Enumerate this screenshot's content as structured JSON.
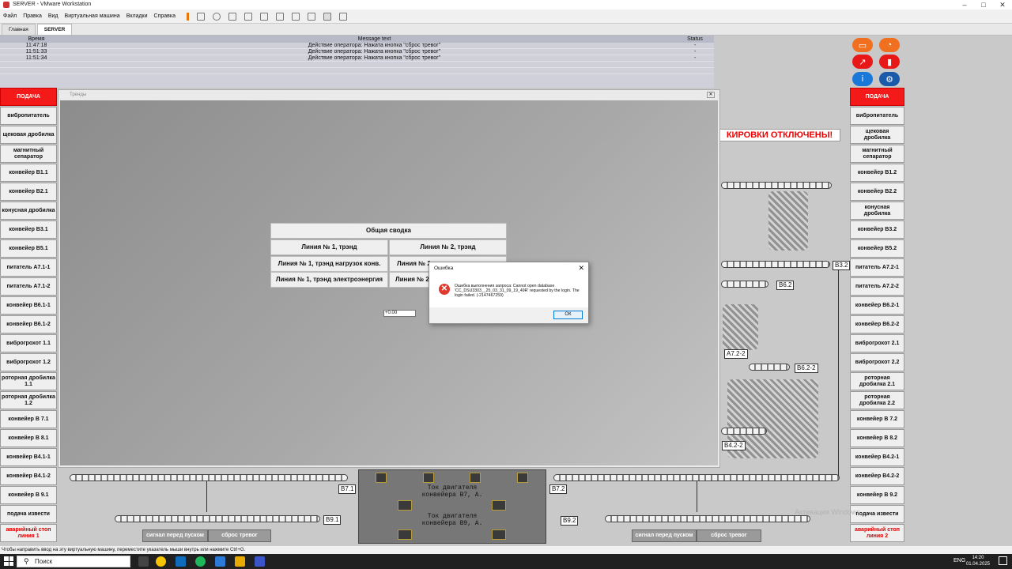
{
  "window": {
    "title": "SERVER - VMware Workstation",
    "controls": [
      "–",
      "□",
      "✕"
    ]
  },
  "menu": [
    "Файл",
    "Правка",
    "Вид",
    "Виртуальная машина",
    "Вкладки",
    "Справка"
  ],
  "tabs": [
    {
      "label": "Главная"
    },
    {
      "label": "SERVER"
    }
  ],
  "alarm": {
    "headers": {
      "time": "Время",
      "message": "Message text",
      "status": "Status"
    },
    "rows": [
      {
        "time": "11:47:18",
        "message": "Действие оператора: Нажата кнопка \"сброс тревог\"",
        "status": "-"
      },
      {
        "time": "11:51:33",
        "message": "Действие оператора: Нажата кнопка \"сброс тревог\"",
        "status": "-"
      },
      {
        "time": "11:51:34",
        "message": "Действие оператора: Нажата кнопка \"сброс тревог\"",
        "status": "-"
      }
    ]
  },
  "left_buttons": [
    "ПОДАЧА",
    "вибропитатель",
    "щековая дробилка",
    "магнитный сепаратор",
    "конвейер В1.1",
    "конвейер В2.1",
    "конусная дробилка",
    "конвейер В3.1",
    "конвейер В5.1",
    "питатель А7.1-1",
    "питатель А7.1-2",
    "конвейер В6.1-1",
    "конвейер В6.1-2",
    "виброгрохот 1.1",
    "виброгрохот 1.2",
    "роторная дробилка 1.1",
    "роторная дробилка 1.2",
    "конвейер В 7.1",
    "конвейер В 8.1",
    "конвейер В4.1-1",
    "конвейер В4.1-2",
    "конвейер В 9.1",
    "подача извести",
    "аварийный стоп линия 1"
  ],
  "right_buttons": [
    "ПОДАЧА",
    "вибропитатель",
    "щековая дробилка",
    "магнитный сепаратор",
    "конвейер В1.2",
    "конвейер В2.2",
    "конусная дробилка",
    "конвейер В3.2",
    "конвейер В5.2",
    "питатель А7.2-1",
    "питатель А7.2-2",
    "конвейер В6.2-1",
    "конвейер В6.2-2",
    "виброгрохот 2.1",
    "виброгрохот 2.2",
    "роторная дробилка 2.1",
    "роторная дробилка 2.2",
    "конвейер В 7.2",
    "конвейер В 8.2",
    "конвейер В4.2-1",
    "конвейер В4.2-2",
    "конвейер В 9.2",
    "подача извести",
    "аварийный стоп линия 2"
  ],
  "trends": {
    "title": "Тренды",
    "summary": "Общая сводка",
    "buttons": [
      "Линия № 1, трэнд",
      "Линия № 2, трэнд",
      "Линия № 1, трэнд нагрузок конв.",
      "Линия № 2",
      "Линия № 1, трэнд электроэнергия",
      "Линия № 2,"
    ],
    "value": "+0.00"
  },
  "dialog": {
    "title": "Ошибка",
    "message": "Ошибка выполнения запроса: Cannot open database 'CC_DSU3303__25_03_31_09_19_49R' requested by the login. The login failed. (-2147467259)",
    "ok": "ОК"
  },
  "warning": "КИРОВКИ ОТКЛЮЧЕНЫ!",
  "tags": {
    "b32": "В3.2",
    "b62": "В6.2",
    "a722": "А7.2-2",
    "b622": "В6.2-2",
    "b422": "В4.2-2",
    "b71": "В7.1",
    "b72": "В7.2",
    "b91": "В9.1",
    "b92": "В9.2"
  },
  "motor": {
    "label1a": "Ток двигателя",
    "label1b": "конвейера В7, А.",
    "label2a": "Ток двигателя",
    "label2b": "конвейера В9, А."
  },
  "bottom": {
    "signal": "сигнал перед пуском",
    "reset": "сброс тревог"
  },
  "watermark": "Активация Windows",
  "statusbar": "Чтобы направить ввод на эту виртуальную машину, переместите указатель мыши внутрь или нажмите Ctrl+G.",
  "taskbar": {
    "search": "Поиск",
    "lang": "ENG",
    "time": "14:20",
    "date": "01.04.2025"
  },
  "colors": {
    "red": "#f41a1a",
    "panel": "#c9c9c9"
  }
}
